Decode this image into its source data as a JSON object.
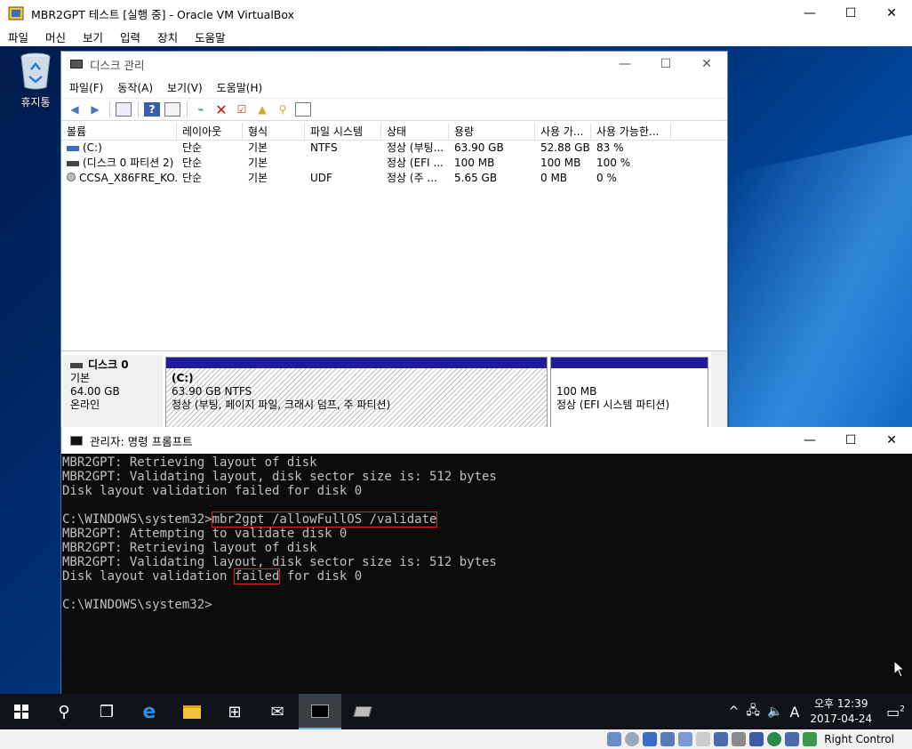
{
  "vbox": {
    "title": "MBR2GPT 테스트 [실행 중] - Oracle VM VirtualBox",
    "menu": [
      "파일",
      "머신",
      "보기",
      "입력",
      "장치",
      "도움말"
    ],
    "status_host_key": "Right Control"
  },
  "desktop": {
    "recycle_bin_label": "휴지통"
  },
  "disk_mgmt": {
    "title": "디스크 관리",
    "menu": [
      "파일(F)",
      "동작(A)",
      "보기(V)",
      "도움말(H)"
    ],
    "columns": [
      "볼륨",
      "레이아웃",
      "형식",
      "파일 시스템",
      "상태",
      "용량",
      "사용 가...",
      "사용 가능한..."
    ],
    "rows": [
      [
        "(C:)",
        "단순",
        "기본",
        "NTFS",
        "정상 (부팅...",
        "63.90 GB",
        "52.88 GB",
        "83 %"
      ],
      [
        "(디스크 0 파티션 2)",
        "단순",
        "기본",
        "",
        "정상 (EFI ...",
        "100 MB",
        "100 MB",
        "100 %"
      ],
      [
        "CCSA_X86FRE_KO...",
        "단순",
        "기본",
        "UDF",
        "정상 (주 ...",
        "5.65 GB",
        "0 MB",
        "0 %"
      ]
    ],
    "disk0": {
      "name": "디스크 0",
      "type": "기본",
      "size": "64.00 GB",
      "status": "온라인",
      "part_c_name": "(C:)",
      "part_c_size": "63.90 GB NTFS",
      "part_c_status": "정상 (부팅, 페이지 파일, 크래시 덤프, 주 파티션)",
      "part_efi_size": "100 MB",
      "part_efi_status": "정상 (EFI 시스템 파티션)"
    }
  },
  "cmd": {
    "title": "관리자: 명령 프롬프트",
    "lines": [
      "MBR2GPT: Retrieving layout of disk",
      "MBR2GPT: Validating layout, disk sector size is: 512 bytes",
      "Disk layout validation failed for disk 0",
      "",
      "",
      "MBR2GPT: Attempting to validate disk 0",
      "MBR2GPT: Retrieving layout of disk",
      "MBR2GPT: Validating layout, disk sector size is: 512 bytes",
      "",
      "",
      "C:\\WINDOWS\\system32>"
    ],
    "prompt": "C:\\WINDOWS\\system32>",
    "command": "mbr2gpt /allowFullOS /validate",
    "fail_prefix": "Disk layout validation ",
    "fail_word": "failed",
    "fail_suffix": " for disk 0"
  },
  "taskbar": {
    "clock_time": "오후 12:39",
    "clock_date": "2017-04-24",
    "ime_label": "A",
    "notif_count": "2"
  },
  "colors": {
    "highlight": "#e02020",
    "disk_bar": "#1c1c9c",
    "cmd_bg": "#0c0c0c"
  }
}
